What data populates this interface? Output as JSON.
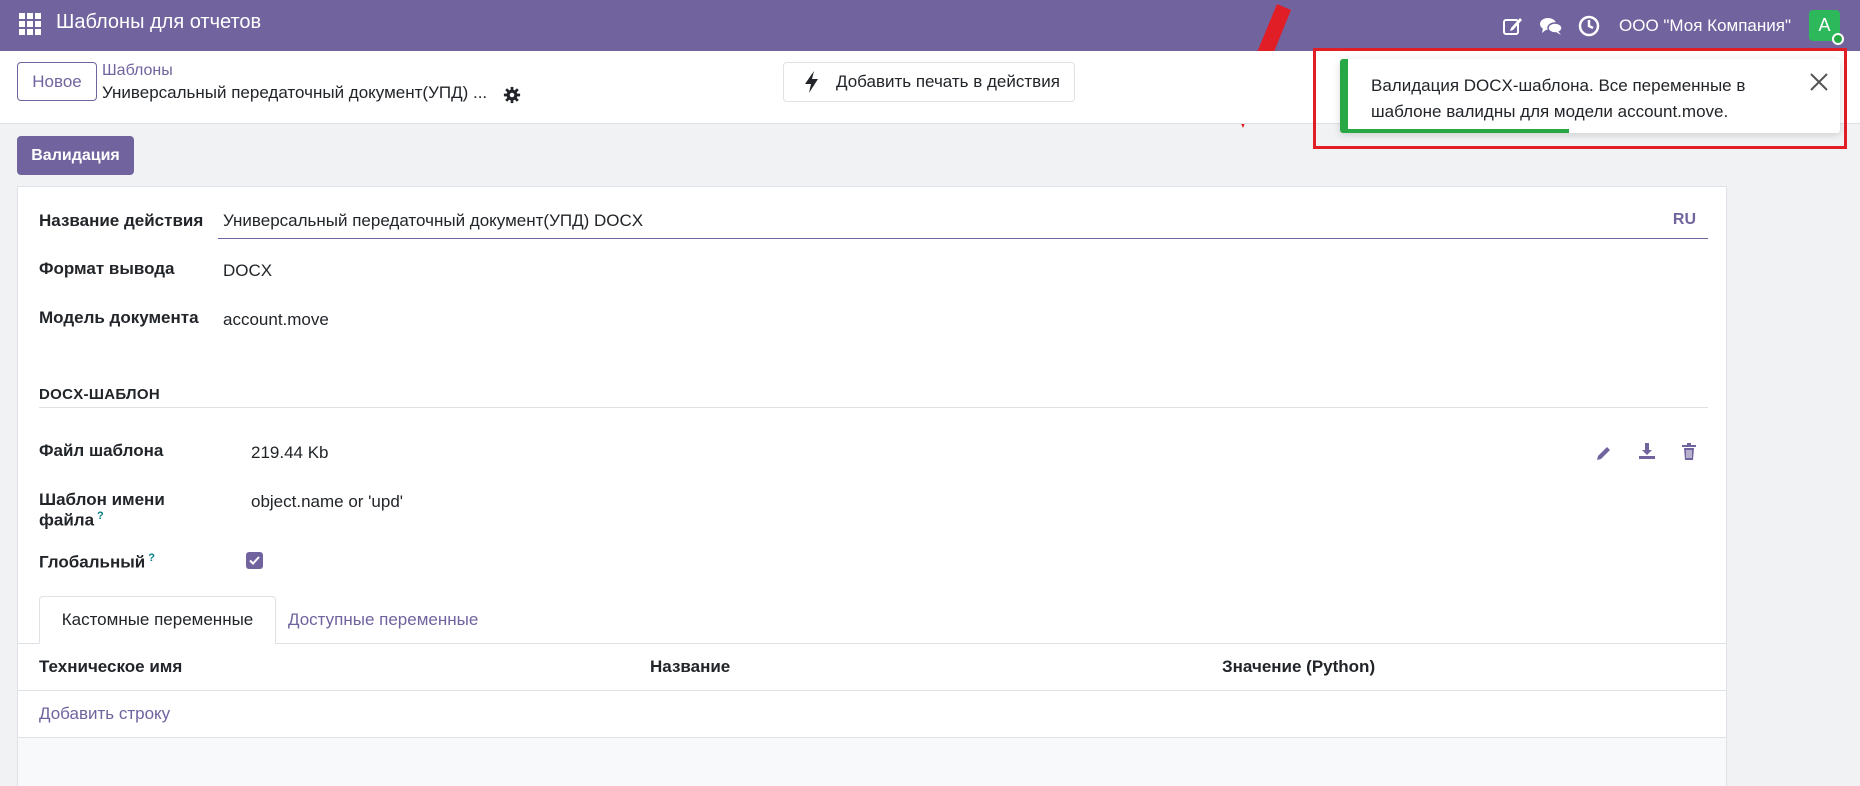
{
  "navbar": {
    "app_title": "Шаблоны для отчетов",
    "company": "ООО \"Моя Компания\"",
    "avatar_letter": "A",
    "brand_color": "#71639e"
  },
  "control_panel": {
    "new_button": "Новое",
    "breadcrumb_parent": "Шаблоны",
    "breadcrumb_current": "Универсальный передаточный документ(УПД) ...",
    "print_button": "Добавить печать в действия"
  },
  "validate_button": "Валидация",
  "form": {
    "action_name_label": "Название действия",
    "action_name_value": "Универсальный передаточный документ(УПД) DOCX",
    "lang_button": "RU",
    "output_format_label": "Формат вывода",
    "output_format_value": "DOCX",
    "doc_model_label": "Модель документа",
    "doc_model_value": "account.move",
    "section_title": "DOCX-ШАБЛОН",
    "template_file_label": "Файл шаблона",
    "template_file_value": "219.44 Kb",
    "filename_template_label_1": "Шаблон имени",
    "filename_template_label_2": "файла",
    "filename_template_value": "object.name or 'upd'",
    "global_label": "Глобальный",
    "global_checked": true,
    "help_mark": "?"
  },
  "tabs": [
    {
      "label": "Кастомные переменные",
      "active": true
    },
    {
      "label": "Доступные переменные",
      "active": false
    }
  ],
  "table": {
    "columns": [
      "Техническое имя",
      "Название",
      "Значение (Python)"
    ],
    "add_row": "Добавить строку"
  },
  "notification": {
    "text": "Валидация DOCX-шаблона. Все переменные в шаблоне валидны для модели account.move.",
    "status_color": "#28a745",
    "progress": 0.45
  },
  "annotation_color": "#e11d26"
}
